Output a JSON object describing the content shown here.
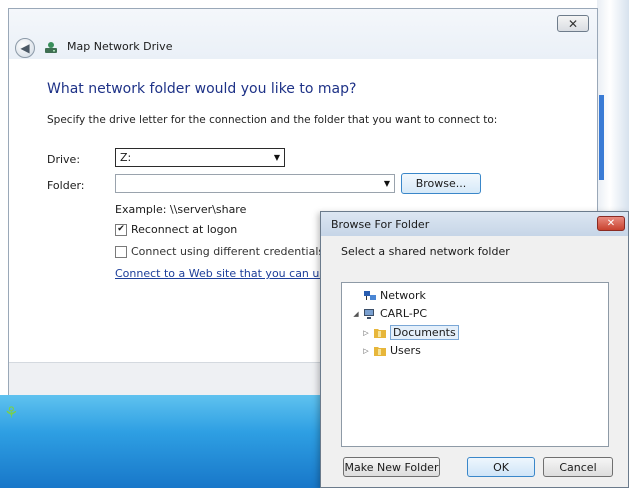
{
  "main_dialog": {
    "title": "Map Network Drive",
    "close_glyph": "✕",
    "heading": "What network folder would you like to map?",
    "instructions": "Specify the drive letter for the connection and the folder that you want to connect to:",
    "drive": {
      "label": "Drive:",
      "value": "Z:"
    },
    "folder": {
      "label": "Folder:",
      "value": ""
    },
    "browse_label": "Browse...",
    "example": "Example: \\\\server\\share",
    "reconnect": {
      "label": "Reconnect at logon",
      "checked": true
    },
    "different_credentials": {
      "label": "Connect using different credentials",
      "checked": false
    },
    "link_text": "Connect to a Web site that you can use to"
  },
  "browse_dialog": {
    "title": "Browse For Folder",
    "close_glyph": "✕",
    "description": "Select a shared network folder",
    "tree": [
      {
        "label": "Network",
        "icon": "network-icon",
        "expander": ""
      },
      {
        "label": "CARL-PC",
        "icon": "computer-icon",
        "expander": "◢"
      },
      {
        "label": "Documents",
        "icon": "folder-icon",
        "expander": "▷",
        "selected": true
      },
      {
        "label": "Users",
        "icon": "folder-icon",
        "expander": "▷"
      }
    ],
    "buttons": {
      "new_folder": "Make New Folder",
      "ok": "OK",
      "cancel": "Cancel"
    }
  },
  "colors": {
    "heading": "#1e3287",
    "link": "#1d3f9a",
    "desktop": "#2e9fe3",
    "close_red": "#c8422f"
  }
}
